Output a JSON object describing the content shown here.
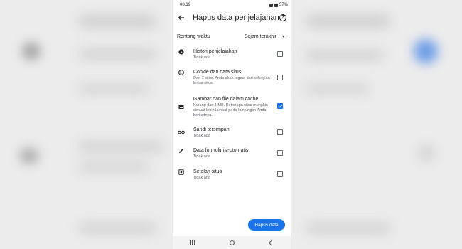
{
  "status_bar": {
    "time": "08.19",
    "battery": "57%"
  },
  "header": {
    "title": "Hapus data penjelajahan",
    "back_icon": "arrow-back-icon",
    "help_icon": "help-icon",
    "help_glyph": "?"
  },
  "time_range": {
    "label": "Rentang waktu",
    "value": "Sejam terakhir"
  },
  "items": [
    {
      "icon": "clock-icon",
      "title": "Histori penjelajahan",
      "subtitle": "Tidak ada",
      "checked": false
    },
    {
      "icon": "cookie-icon",
      "title": "Cookie dan data situs",
      "subtitle": "Dari 7 situs. Anda akan logout dari sebagian besar situs.",
      "checked": false
    },
    {
      "icon": "image-icon",
      "title": "Gambar dan file dalam cache",
      "subtitle": "Kurang dari 1 MB. Beberapa situs mungkin dimuat lebih lambat pada kunjungan Anda berikutnya.",
      "checked": true
    },
    {
      "icon": "key-icon",
      "title": "Sandi tersimpan",
      "subtitle": "Tidak ada",
      "checked": false
    },
    {
      "icon": "pencil-icon",
      "title": "Data formulir isi-otomatis",
      "subtitle": "Tidak ada",
      "checked": false
    },
    {
      "icon": "site-settings-icon",
      "title": "Setelan situs",
      "subtitle": "Tidak ada",
      "checked": false
    }
  ],
  "clear_button": {
    "label": "Hapus data"
  },
  "colors": {
    "accent": "#1a73e8",
    "text_primary": "#202124",
    "text_secondary": "#5f6368"
  }
}
